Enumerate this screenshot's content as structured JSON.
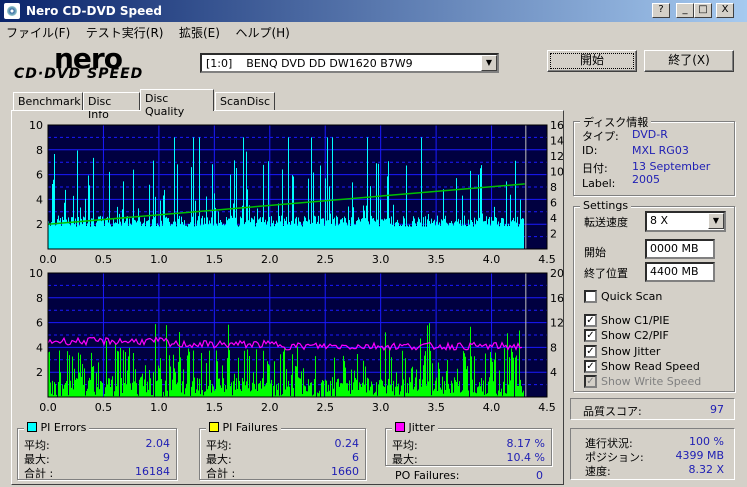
{
  "window": {
    "title": "Nero CD-DVD Speed",
    "btn_help": "?",
    "btn_min": "_",
    "btn_max": "□",
    "btn_close": "X"
  },
  "menu": [
    "ファイル(F)",
    "テスト実行(R)",
    "拡張(E)",
    "ヘルプ(H)"
  ],
  "logo": {
    "brand": "nero",
    "product": "CD·DVD SPEED"
  },
  "drive": {
    "selected": "[1:0]    BENQ DVD DD DW1620 B7W9"
  },
  "buttons": {
    "start": "開始",
    "exit": "終了(X)"
  },
  "tabs": [
    "Benchmark",
    "Disc Info",
    "Disc Quality",
    "ScanDisc"
  ],
  "active_tab": "Disc Quality",
  "disc_info": {
    "title": "ディスク情報",
    "type_label": "タイプ:",
    "type_value": "DVD-R",
    "id_label": "ID:",
    "id_value": "MXL RG03",
    "date_label": "日付:",
    "date_value": "13 September 2005",
    "label_label": "Label:",
    "label_value": ""
  },
  "settings": {
    "title": "Settings",
    "speed_label": "転送速度",
    "speed_value": "8 X",
    "start_label": "開始",
    "start_value": "0000 MB",
    "end_label": "終了位置",
    "end_value": "4400 MB",
    "quick_scan": {
      "label": "Quick Scan",
      "checked": false
    },
    "show_c1": {
      "label": "Show C1/PIE",
      "checked": true
    },
    "show_c2": {
      "label": "Show C2/PIF",
      "checked": true
    },
    "show_jitter": {
      "label": "Show Jitter",
      "checked": true
    },
    "show_read": {
      "label": "Show Read Speed",
      "checked": true
    },
    "show_write": {
      "label": "Show Write Speed",
      "checked": true,
      "disabled": true
    }
  },
  "quality_score": {
    "label": "品質スコア:",
    "value": "97"
  },
  "progress": {
    "status_label": "進行状況:",
    "status_value": "100 %",
    "position_label": "ポジション:",
    "position_value": "4399 MB",
    "speed_label": "速度:",
    "speed_value": "8.32 X"
  },
  "pi_errors": {
    "title": "PI Errors",
    "color": "#00ffff",
    "avg_label": "平均:",
    "avg": "2.04",
    "max_label": "最大:",
    "max": "9",
    "total_label": "合計 :",
    "total": "16184"
  },
  "pi_failures": {
    "title": "PI Failures",
    "color": "#ffff00",
    "avg_label": "平均:",
    "avg": "0.24",
    "max_label": "最大:",
    "max": "6",
    "total_label": "合計 :",
    "total": "1660"
  },
  "jitter": {
    "title": "Jitter",
    "color": "#ff00ff",
    "avg_label": "平均:",
    "avg": "8.17 %",
    "max_label": "最大:",
    "max": "10.4 %"
  },
  "po_failures": {
    "label": "PO Failures:",
    "value": "0"
  },
  "colors": {
    "chart_bg": "#000040",
    "grid": "#1a1aff",
    "pie": "#00ffff",
    "pif": "#00ff00",
    "jitter": "#ff00ff",
    "read_speed": "#00c000"
  },
  "chart_data": [
    {
      "type": "bar",
      "name": "top",
      "x_ticks": [
        "0.0",
        "0.5",
        "1.0",
        "1.5",
        "2.0",
        "2.5",
        "3.0",
        "3.5",
        "4.0",
        "4.5"
      ],
      "y_left_ticks": [
        "10",
        "8",
        "6",
        "4",
        "2"
      ],
      "y_right_ticks": [
        "16",
        "14",
        "12",
        "10",
        "8",
        "6",
        "4",
        "2"
      ],
      "xlim": [
        0,
        4.5
      ],
      "ylim_left": [
        0,
        10
      ],
      "ylim_right": [
        0,
        16
      ],
      "data_end_x": 4.3,
      "series": [
        {
          "name": "PI Errors",
          "baseline": 2.0,
          "peak_max": 9
        },
        {
          "name": "Read Speed",
          "start": 3.2,
          "end": 8.4
        }
      ]
    },
    {
      "type": "bar",
      "name": "bottom",
      "x_ticks": [
        "0.0",
        "0.5",
        "1.0",
        "1.5",
        "2.0",
        "2.5",
        "3.0",
        "3.5",
        "4.0",
        "4.5"
      ],
      "y_left_ticks": [
        "10",
        "8",
        "6",
        "4",
        "2"
      ],
      "y_right_ticks": [
        "20",
        "16",
        "12",
        "8",
        "4"
      ],
      "xlim": [
        0,
        4.5
      ],
      "ylim_left": [
        0,
        10
      ],
      "ylim_right": [
        0,
        20
      ],
      "data_end_x": 4.3,
      "series": [
        {
          "name": "PI Failures",
          "peak_max": 6
        },
        {
          "name": "Jitter",
          "avg": 8.17,
          "max": 10.4
        }
      ]
    }
  ]
}
